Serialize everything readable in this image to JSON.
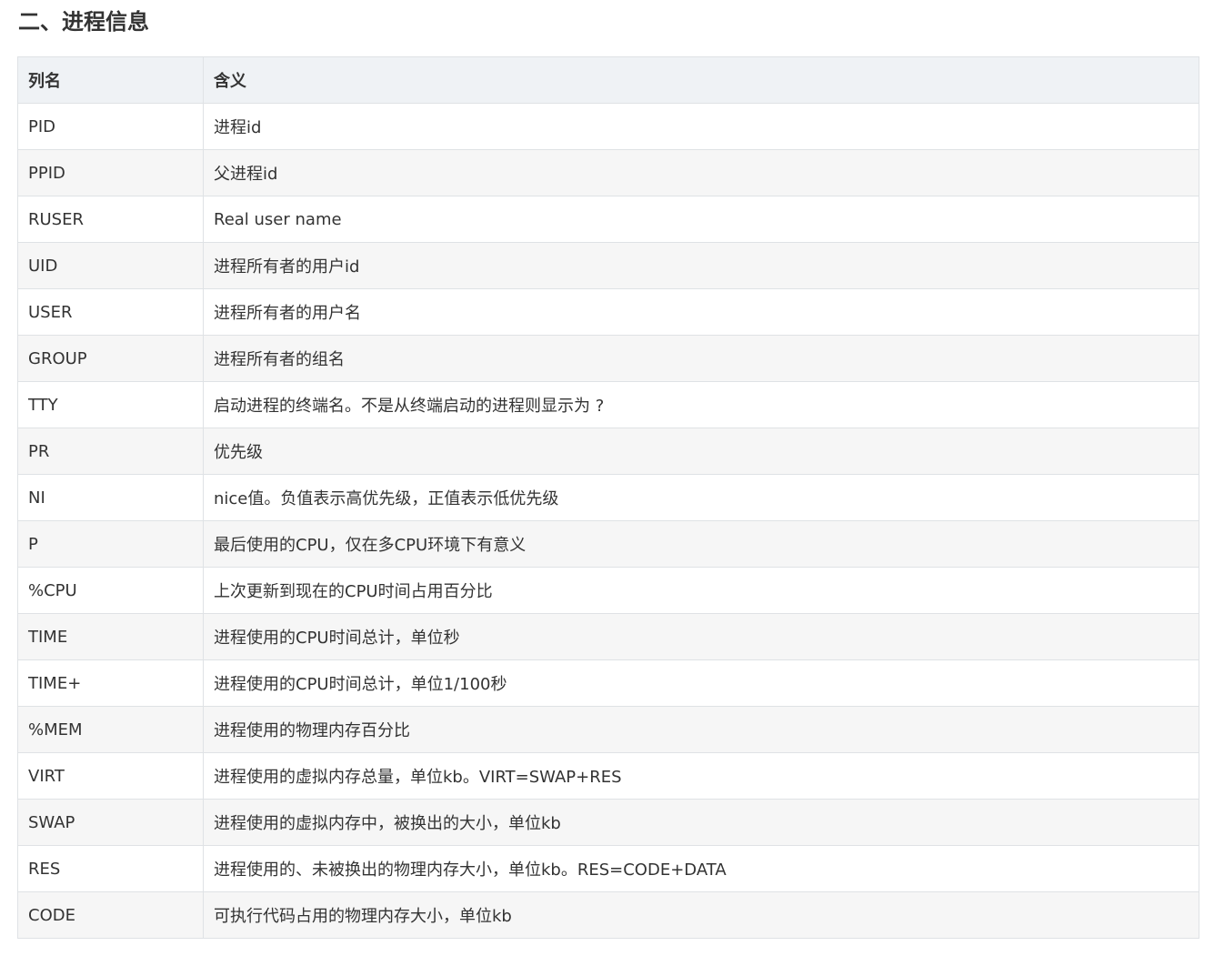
{
  "section_title": "二、进程信息",
  "table": {
    "headers": [
      "列名",
      "含义"
    ],
    "rows": [
      [
        "PID",
        "进程id"
      ],
      [
        "PPID",
        "父进程id"
      ],
      [
        "RUSER",
        "Real user name"
      ],
      [
        "UID",
        "进程所有者的用户id"
      ],
      [
        "USER",
        "进程所有者的用户名"
      ],
      [
        "GROUP",
        "进程所有者的组名"
      ],
      [
        "TTY",
        "启动进程的终端名。不是从终端启动的进程则显示为 ?"
      ],
      [
        "PR",
        "优先级"
      ],
      [
        "NI",
        "nice值。负值表示高优先级，正值表示低优先级"
      ],
      [
        "P",
        "最后使用的CPU，仅在多CPU环境下有意义"
      ],
      [
        "%CPU",
        "上次更新到现在的CPU时间占用百分比"
      ],
      [
        "TIME",
        "进程使用的CPU时间总计，单位秒"
      ],
      [
        "TIME+",
        "进程使用的CPU时间总计，单位1/100秒"
      ],
      [
        "%MEM",
        "进程使用的物理内存百分比"
      ],
      [
        "VIRT",
        "进程使用的虚拟内存总量，单位kb。VIRT=SWAP+RES"
      ],
      [
        "SWAP",
        "进程使用的虚拟内存中，被换出的大小，单位kb"
      ],
      [
        "RES",
        "进程使用的、未被换出的物理内存大小，单位kb。RES=CODE+DATA"
      ],
      [
        "CODE",
        "可执行代码占用的物理内存大小，单位kb"
      ]
    ]
  }
}
